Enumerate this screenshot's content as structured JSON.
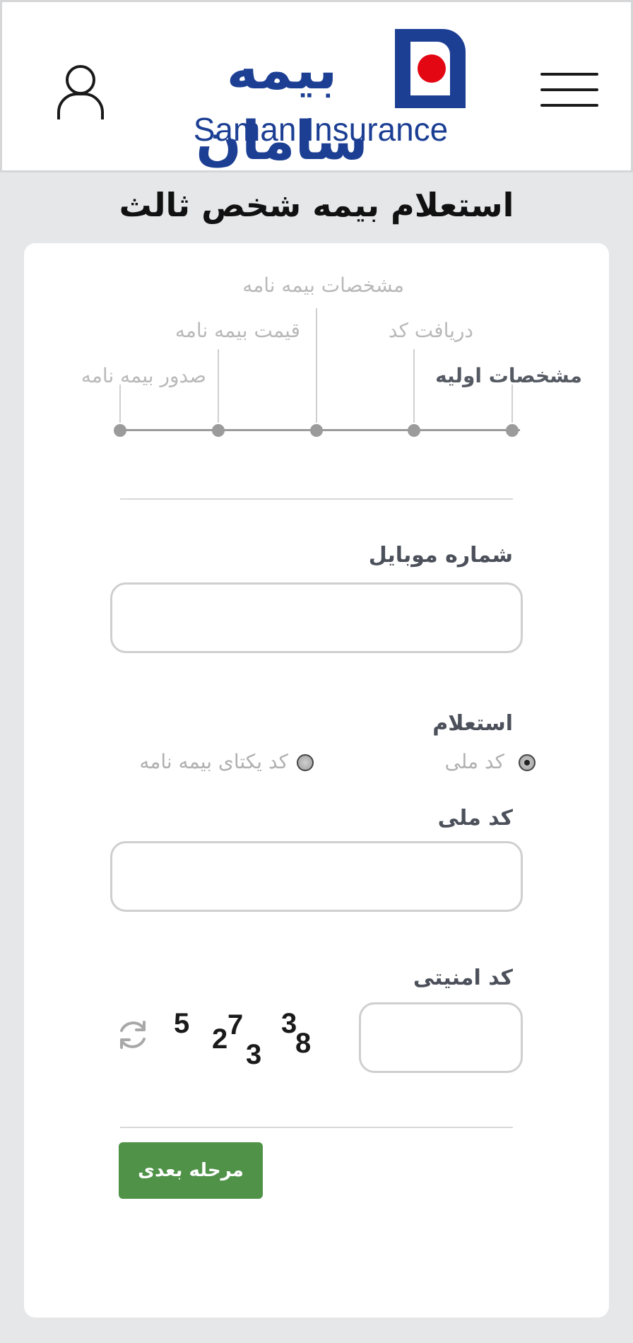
{
  "header": {
    "logo_fa": "بیمه سامان",
    "logo_en": "Saman Insurance",
    "brand_color": "#1c3f94",
    "logo_dot_color": "#e30613"
  },
  "page_title": "استعلام بیمه شخص ثالث",
  "steps": [
    {
      "label": "مشخصات اولیه",
      "active": true
    },
    {
      "label": "دریافت کد",
      "active": false
    },
    {
      "label": "مشخصات بیمه نامه",
      "active": false
    },
    {
      "label": "قیمت بیمه نامه",
      "active": false
    },
    {
      "label": "صدور بیمه نامه",
      "active": false
    }
  ],
  "form": {
    "mobile_label": "شماره موبایل",
    "mobile_value": "",
    "inquiry_label": "استعلام",
    "radio_options": [
      {
        "label": "کد ملی",
        "checked": true
      },
      {
        "label": "کد یکتای بیمه نامه",
        "checked": false
      }
    ],
    "national_code_label": "کد ملی",
    "national_code_value": "",
    "security_code_label": "کد امنیتی",
    "security_code_value": "",
    "captcha_chars": [
      "5",
      "2",
      "7",
      "3",
      "3",
      "8"
    ],
    "next_button": "مرحله بعدی",
    "button_color": "#4f9248"
  }
}
